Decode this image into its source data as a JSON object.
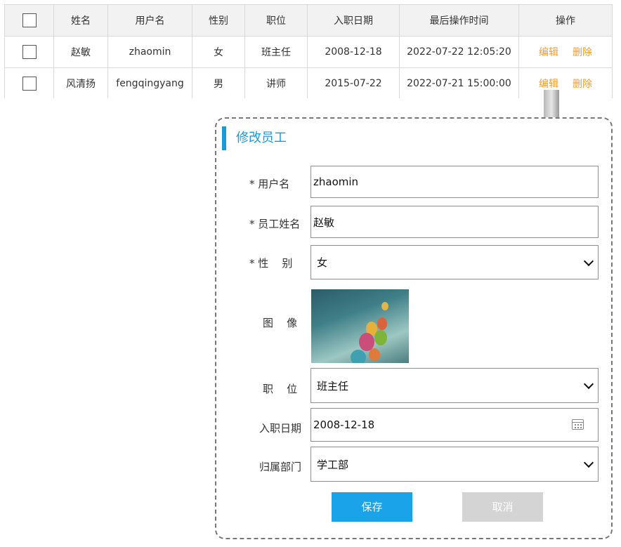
{
  "table": {
    "headers": [
      "",
      "姓名",
      "用户名",
      "性别",
      "职位",
      "入职日期",
      "最后操作时间",
      "操作"
    ],
    "rows": [
      {
        "name": "赵敏",
        "username": "zhaomin",
        "gender": "女",
        "position": "班主任",
        "hire_date": "2008-12-18",
        "last_op": "2022-07-22 12:05:20",
        "edit": "编辑",
        "delete": "删除"
      },
      {
        "name": "风清扬",
        "username": "fengqingyang",
        "gender": "男",
        "position": "讲师",
        "hire_date": "2015-07-22",
        "last_op": "2022-07-21 15:00:00",
        "edit": "编辑",
        "delete": "删除"
      }
    ]
  },
  "dialog": {
    "title": "修改员工",
    "username_label": "* 用户名",
    "username_value": "zhaomin",
    "realname_label": "* 员工姓名",
    "realname_value": "赵敏",
    "gender_label": "* 性    别",
    "gender_value": "女",
    "image_label": "图    像",
    "position_label": "职    位",
    "position_value": "班主任",
    "hire_date_label": "入职日期",
    "hire_date_value": "2008-12-18",
    "dept_label": "归属部门",
    "dept_value": "学工部",
    "save_label": "保存",
    "cancel_label": "取消"
  },
  "colors": {
    "accent": "#1a9ad8",
    "action": "#f39c2c",
    "save": "#1aa3e8",
    "cancel": "#d4d4d4"
  },
  "icons": [
    "checkbox-icon",
    "chevron-down-icon",
    "calendar-icon",
    "arrow-down-icon"
  ]
}
